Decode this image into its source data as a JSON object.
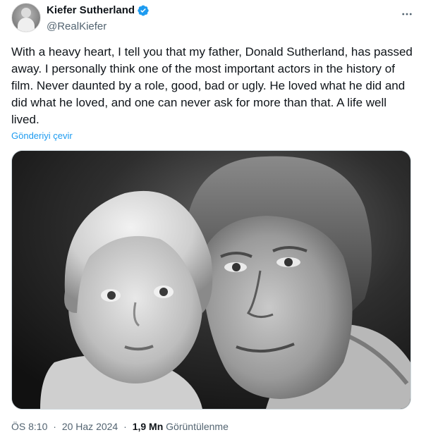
{
  "tweet": {
    "author": {
      "display_name": "Kiefer Sutherland",
      "handle": "@RealKiefer",
      "verified": true,
      "verified_color": "#1d9bf0"
    },
    "more_icon": "ellipsis-icon",
    "text": "With a heavy heart, I tell you that my father, Donald Sutherland, has passed away. I personally think one of the most important actors in the history of film. Never daunted by a role, good, bad or ugly. He loved what he did and did what he loved, and one can never ask for more than that. A life well lived.",
    "translate_label": "Gönderiyi çevir",
    "media": {
      "type": "photo",
      "style": "black-and-white"
    },
    "meta": {
      "time": "ÖS 8:10",
      "date": "20 Haz 2024",
      "separator": "·",
      "view_count": "1,9 Mn",
      "view_label": "Görüntülenme"
    }
  },
  "colors": {
    "text": "#0f1419",
    "secondary": "#536471",
    "link": "#1d9bf0",
    "border": "#cfd9de"
  }
}
